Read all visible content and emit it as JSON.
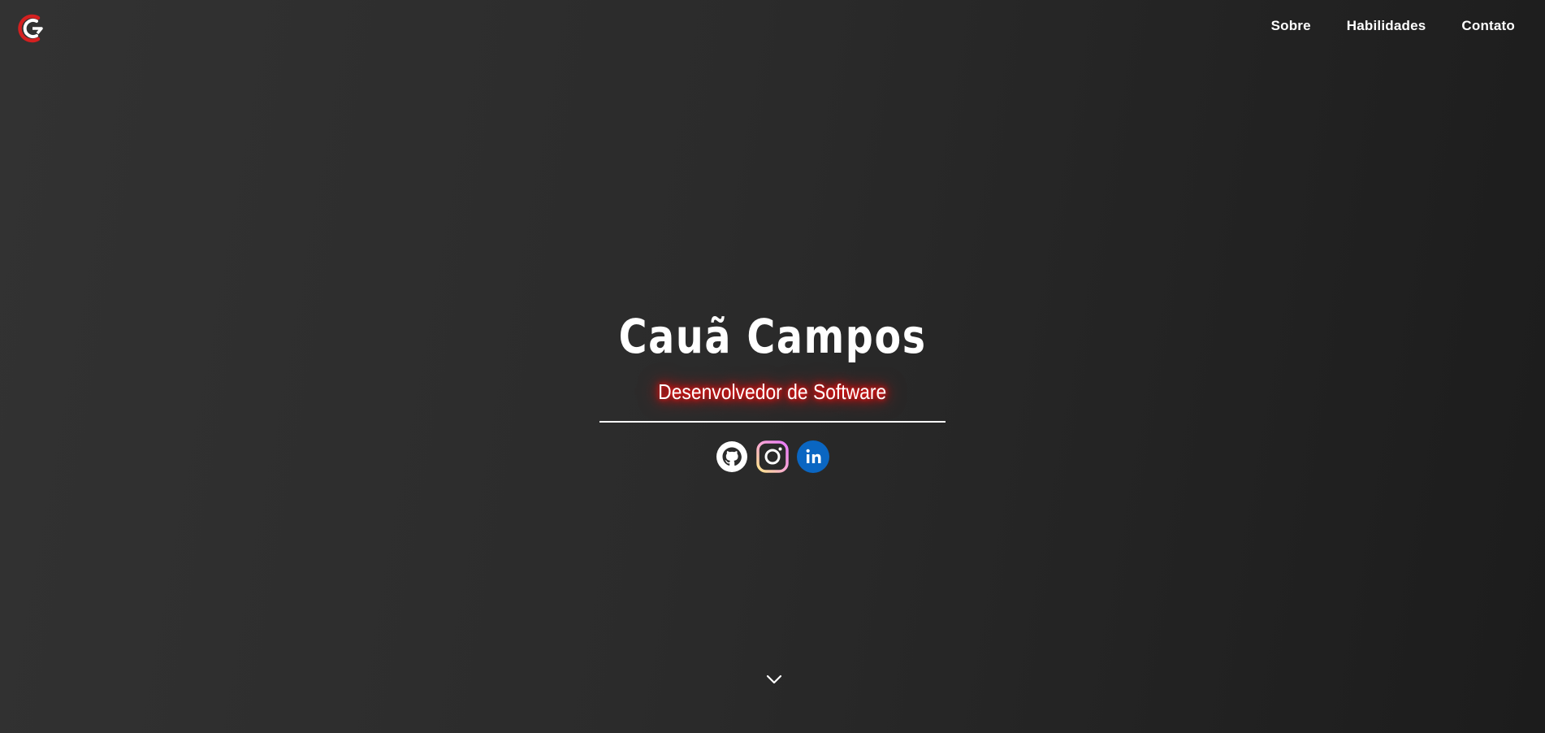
{
  "header": {
    "logo_icon": "c-logo-icon",
    "nav": [
      {
        "label": "Sobre"
      },
      {
        "label": "Habilidades"
      },
      {
        "label": "Contato"
      }
    ]
  },
  "hero": {
    "name": "Cauã Campos",
    "subtitle": "Desenvolvedor de Software",
    "socials": [
      {
        "icon": "github-icon"
      },
      {
        "icon": "instagram-icon"
      },
      {
        "icon": "linkedin-icon"
      }
    ],
    "scroll_icon": "chevron-down-icon"
  },
  "colors": {
    "background": "#2b2b2b",
    "accent_red": "#e02020",
    "subtitle_glow": "#ff0000",
    "linkedin": "#0a66c2"
  }
}
